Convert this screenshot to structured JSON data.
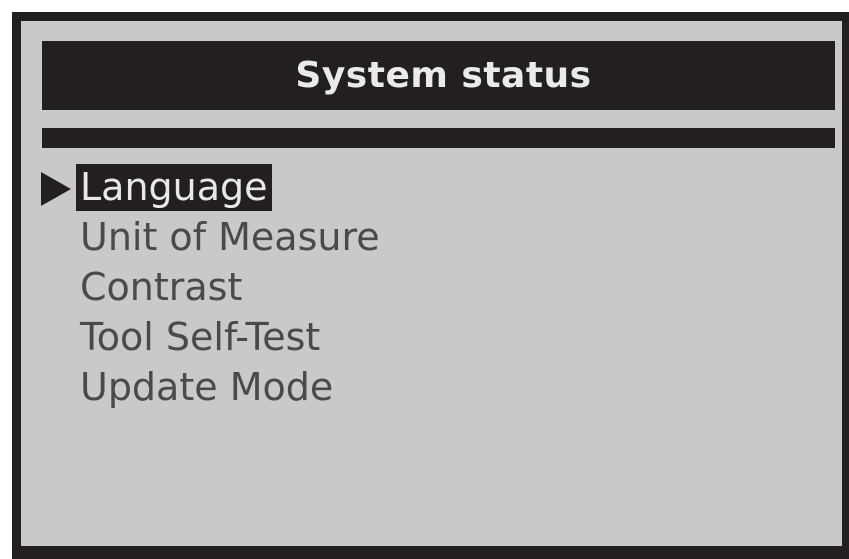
{
  "screen": {
    "title": "System status",
    "menu": {
      "items": [
        {
          "label": "Language",
          "selected": true
        },
        {
          "label": "Unit of Measure",
          "selected": false
        },
        {
          "label": "Contrast",
          "selected": false
        },
        {
          "label": "Tool Self-Test",
          "selected": false
        },
        {
          "label": "Update Mode",
          "selected": false
        }
      ]
    }
  },
  "icons": {
    "cursor": "triangle-right-icon"
  },
  "colors": {
    "bezel": "#231f20",
    "screen_background": "#c8c9cb",
    "title_text": "#eaeaea",
    "menu_text": "#4a4a4c",
    "highlight_background": "#231f20",
    "highlight_text": "#e8e8e8"
  }
}
